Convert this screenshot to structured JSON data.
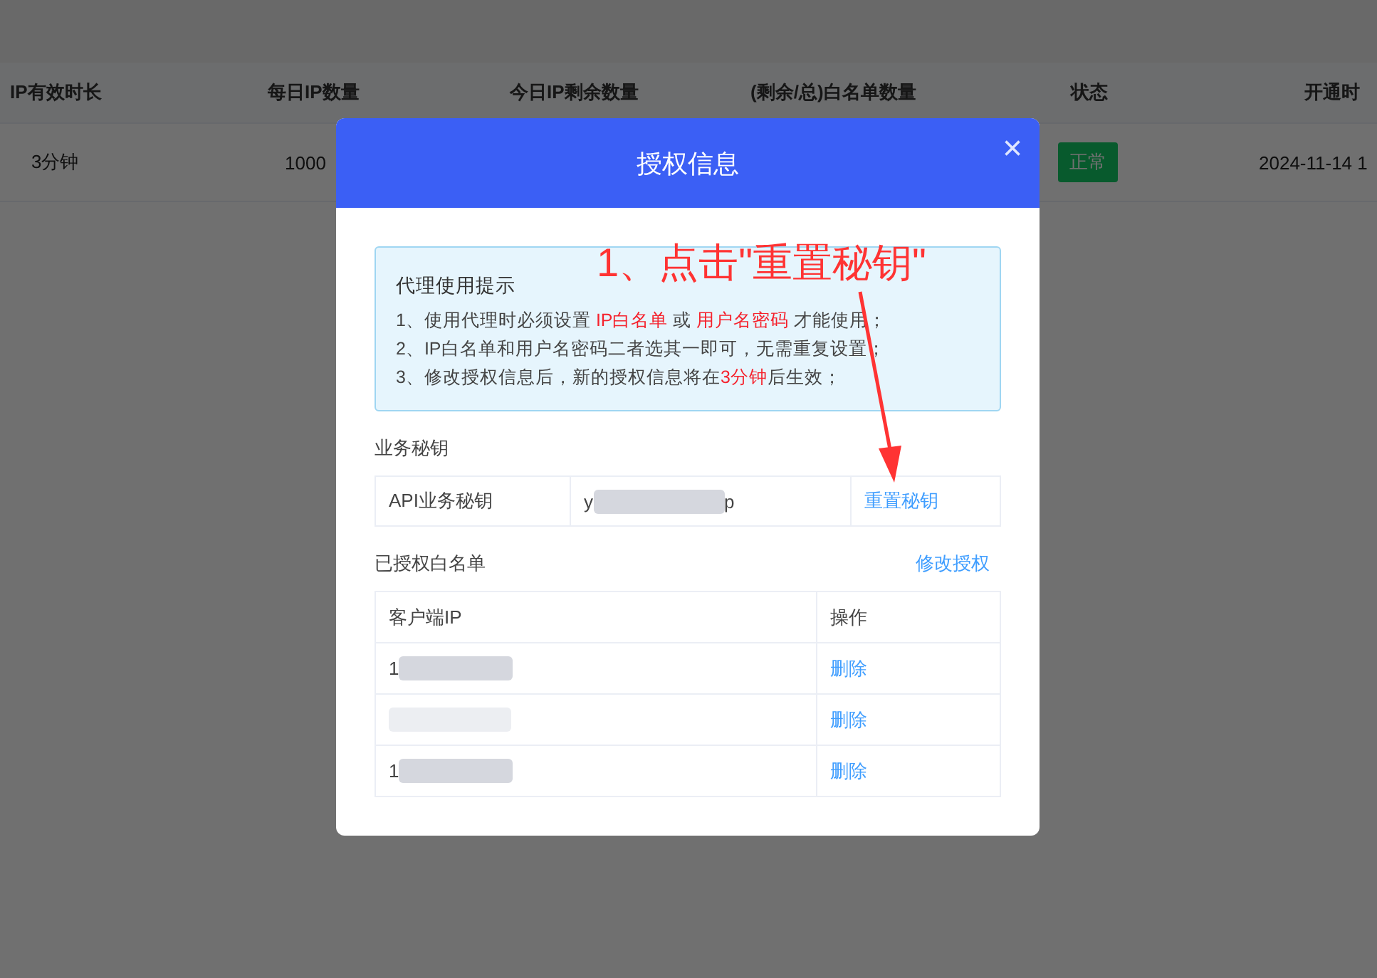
{
  "background_table": {
    "columns": [
      "IP有效时长",
      "每日IP数量",
      "今日IP剩余数量",
      "(剩余/总)白名单数量",
      "状态",
      "开通时"
    ],
    "row": {
      "duration": "3分钟",
      "daily_ip": "1000",
      "status": "正常",
      "opened": "2024-11-14 1"
    }
  },
  "dialog": {
    "title": "授权信息",
    "close": "×",
    "tips": {
      "title": "代理使用提示",
      "lines": [
        "1、使用代理时必须设置 **IP白名单** 或 **用户名密码** 才能使用；",
        "2、IP白名单和用户名密码二者选其一即可，无需重复设置；",
        "3、修改授权信息后，新的授权信息将在**3分钟**后生效；"
      ]
    },
    "key_section": {
      "label": "业务秘钥",
      "name": "API业务秘钥",
      "value_start": "y",
      "value_end": "p",
      "action": "重置秘钥"
    },
    "whitelist": {
      "label": "已授权白名单",
      "edit": "修改授权",
      "columns": [
        "客户端IP",
        "操作"
      ],
      "rows": [
        {
          "ip_start": "1",
          "action": "删除"
        },
        {
          "ip_start": "",
          "action": "删除"
        },
        {
          "ip_start": "1",
          "action": "删除"
        }
      ]
    }
  },
  "annotation": {
    "text": "1、点击\"重置秘钥\""
  }
}
